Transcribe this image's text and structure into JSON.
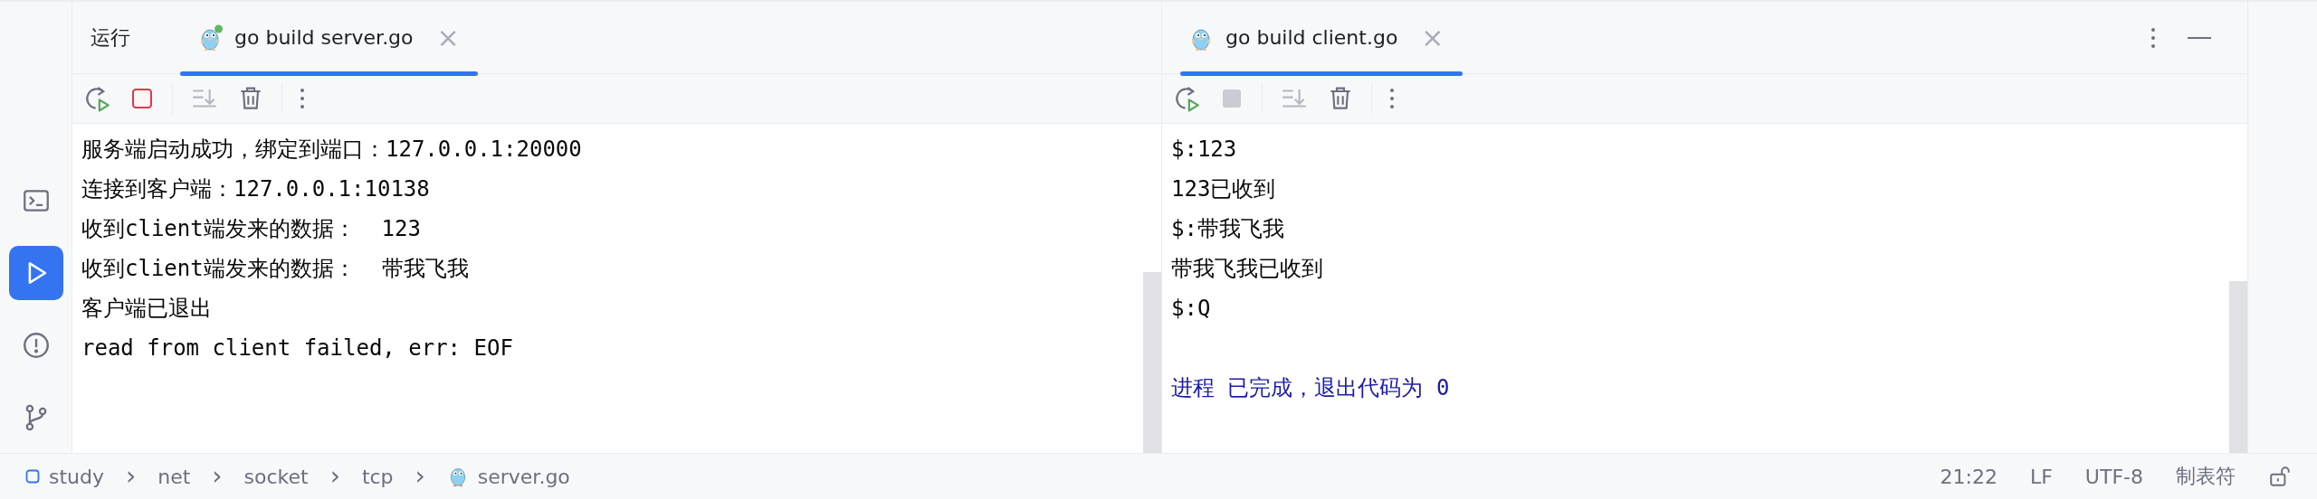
{
  "sidebar": {
    "items": [
      {
        "kind": "terminal",
        "selected": false
      },
      {
        "kind": "run",
        "selected": true
      },
      {
        "kind": "problems",
        "selected": false
      },
      {
        "kind": "git",
        "selected": false
      }
    ]
  },
  "panes": [
    {
      "title": "运行",
      "tab": {
        "label": "go build server.go",
        "selected": true,
        "running": true,
        "close": "×"
      },
      "stop_disabled": false,
      "lines": [
        {
          "kind": "output",
          "text": "服务端启动成功，绑定到端口：127.0.0.1:20000"
        },
        {
          "kind": "output",
          "text": "连接到客户端：127.0.0.1:10138"
        },
        {
          "kind": "output",
          "text": "收到client端发来的数据：  123"
        },
        {
          "kind": "output",
          "text": "收到client端发来的数据：  带我飞我"
        },
        {
          "kind": "output",
          "text": "客户端已退出"
        },
        {
          "kind": "output",
          "text": "read from client failed, err: EOF"
        }
      ]
    },
    {
      "tab": {
        "label": "go build client.go",
        "selected": true,
        "running": false,
        "close": "×"
      },
      "stop_disabled": true,
      "lines": [
        {
          "kind": "output",
          "text": "$:123"
        },
        {
          "kind": "output",
          "text": "123已收到"
        },
        {
          "kind": "output",
          "text": "$:带我飞我"
        },
        {
          "kind": "output",
          "text": "带我飞我已收到"
        },
        {
          "kind": "output",
          "text": "$:Q"
        },
        {
          "kind": "exit",
          "text": "进程 已完成，退出代码为 0"
        }
      ]
    }
  ],
  "status_bar": {
    "breadcrumbs": [
      {
        "kind": "module",
        "label": "study"
      },
      {
        "kind": "folder",
        "label": "net"
      },
      {
        "kind": "folder",
        "label": "socket"
      },
      {
        "kind": "folder",
        "label": "tcp"
      },
      {
        "kind": "gofile",
        "label": "server.go"
      }
    ],
    "separator": "›",
    "position": "21:22",
    "line_ending": "LF",
    "encoding": "UTF-8",
    "indent": "制表符"
  }
}
